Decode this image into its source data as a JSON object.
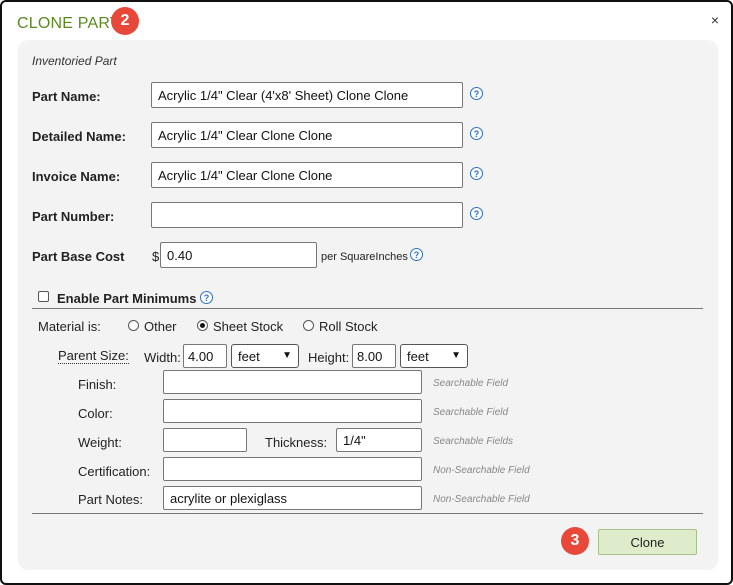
{
  "dialog": {
    "title": "CLONE PART",
    "close_glyph": "×",
    "badge_title": "2",
    "badge_clone": "3"
  },
  "form": {
    "subheading": "Inventoried Part",
    "part_name": {
      "label": "Part Name:",
      "value": "Acrylic 1/4\" Clear (4'x8' Sheet) Clone Clone"
    },
    "detailed_name": {
      "label": "Detailed Name:",
      "value": "Acrylic 1/4\" Clear Clone Clone"
    },
    "invoice_name": {
      "label": "Invoice Name:",
      "value": "Acrylic 1/4\" Clear Clone Clone"
    },
    "part_number": {
      "label": "Part Number:",
      "value": ""
    },
    "base_cost": {
      "label": "Part Base Cost",
      "currency": "$",
      "value": "0.40",
      "unit": "per SquareInches"
    },
    "help_glyph": "?",
    "enable_minimums": {
      "label": "Enable Part Minimums",
      "checked": false
    },
    "material": {
      "label": "Material is:",
      "options": [
        "Other",
        "Sheet Stock",
        "Roll Stock"
      ],
      "selected": "Sheet Stock"
    },
    "parent_size": {
      "label": "Parent Size:",
      "width_label": "Width:",
      "width_value": "4.00",
      "width_unit": "feet",
      "height_label": "Height:",
      "height_value": "8.00",
      "height_unit": "feet"
    },
    "finish": {
      "label": "Finish:",
      "value": "",
      "hint": "Searchable Field"
    },
    "color": {
      "label": "Color:",
      "value": "",
      "hint": "Searchable Field"
    },
    "weight": {
      "label": "Weight:",
      "value": ""
    },
    "thickness": {
      "label": "Thickness:",
      "value": "1/4\"",
      "hint": "Searchable Fields"
    },
    "certification": {
      "label": "Certification:",
      "value": "",
      "hint": "Non-Searchable Field"
    },
    "part_notes": {
      "label": "Part Notes:",
      "value": "acrylite or plexiglass",
      "hint": "Non-Searchable Field"
    },
    "clone_button": "Clone"
  },
  "colors": {
    "title": "#5a8a1f",
    "badge": "#e8483a",
    "help": "#2a6fc9",
    "button_bg": "#dfeccc"
  },
  "icons": [
    "help-icon",
    "close-icon",
    "chevron-down-icon"
  ]
}
